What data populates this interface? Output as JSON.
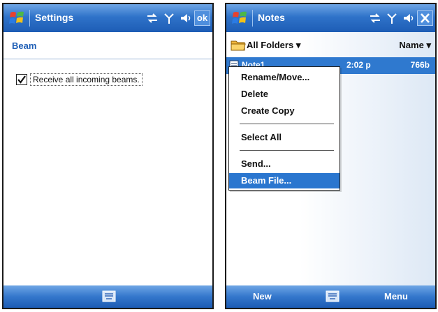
{
  "settings_screen": {
    "title": "Settings",
    "ok_label": "ok",
    "section_title": "Beam",
    "checkbox_label": "Receive all incoming beams.",
    "checkbox_checked": true
  },
  "notes_screen": {
    "title": "Notes",
    "folder_label": "All Folders",
    "sort_label": "Name",
    "note": {
      "name": "Note1",
      "time": "2:02 p",
      "size": "766b"
    },
    "menu_items": [
      "Rename/Move...",
      "Delete",
      "Create Copy",
      "Select All",
      "Send...",
      "Beam File..."
    ],
    "selected_menu_item": "Beam File...",
    "softkey_left": "New",
    "softkey_right": "Menu"
  },
  "colors": {
    "titlebar": "#2f73c9",
    "selection": "#2a76cf",
    "section_title": "#1f5fb6"
  },
  "icons": [
    "windows-flag-icon",
    "connectivity-icon",
    "antenna-icon",
    "speaker-icon",
    "keyboard-icon",
    "folder-icon",
    "note-icon",
    "close-icon",
    "checkmark-icon"
  ]
}
